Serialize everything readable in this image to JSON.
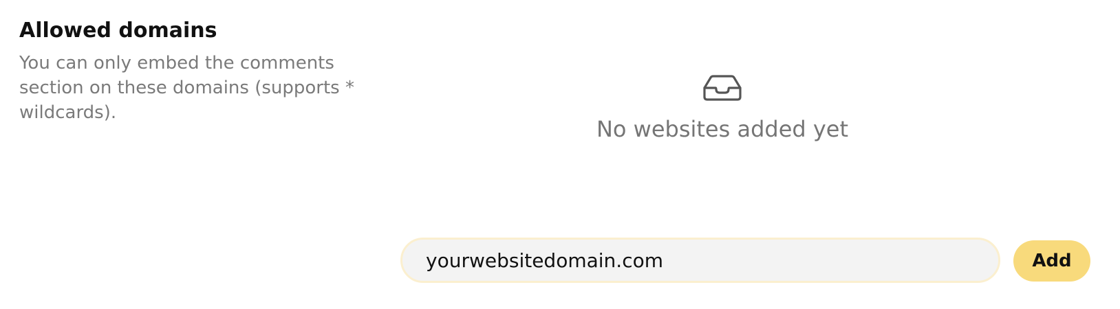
{
  "section": {
    "title": "Allowed domains",
    "description": "You can only embed the comments section on these domains (supports * wildcards)."
  },
  "empty_state": {
    "icon": "inbox-icon",
    "message": "No websites added yet"
  },
  "domain_input": {
    "value": "yourwebsitedomain.com",
    "placeholder": ""
  },
  "add_button": {
    "label": "Add"
  },
  "colors": {
    "accent": "#f8da7c",
    "input_border": "#fbefcf",
    "input_background": "#f3f3f3",
    "muted_text": "#7a7a7a"
  }
}
